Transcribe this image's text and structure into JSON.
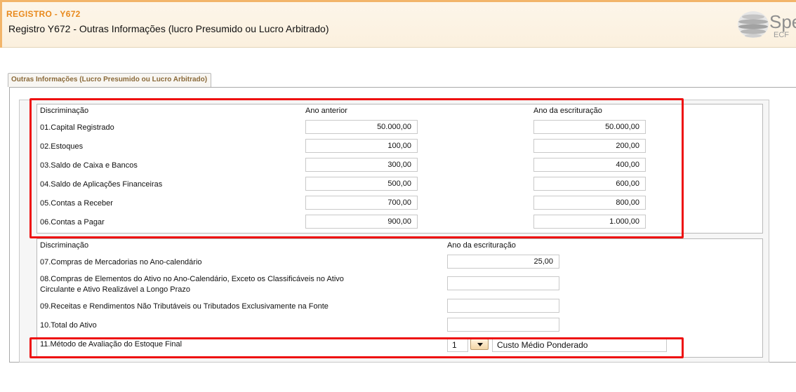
{
  "header": {
    "register_code": "REGISTRO - Y672",
    "register_title": "Registro Y672 - Outras Informações (lucro Presumido ou Lucro Arbitrado)",
    "logo_text": "Spe",
    "logo_sub": "ECF",
    "accent_color": "#e8891c"
  },
  "tab": {
    "label": "Outras Informações (Lucro Presumido ou Lucro Arbitrado)"
  },
  "section1": {
    "col_discriminacao": "Discriminação",
    "col_ano_anterior": "Ano anterior",
    "col_ano_escrituracao": "Ano da escrituração",
    "rows": [
      {
        "label": "01.Capital Registrado",
        "ano_anterior": "50.000,00",
        "ano_escrituracao": "50.000,00"
      },
      {
        "label": "02.Estoques",
        "ano_anterior": "100,00",
        "ano_escrituracao": "200,00"
      },
      {
        "label": "03.Saldo de Caixa e Bancos",
        "ano_anterior": "300,00",
        "ano_escrituracao": "400,00"
      },
      {
        "label": "04.Saldo de Aplicações Financeiras",
        "ano_anterior": "500,00",
        "ano_escrituracao": "600,00"
      },
      {
        "label": "05.Contas a Receber",
        "ano_anterior": "700,00",
        "ano_escrituracao": "800,00"
      },
      {
        "label": "06.Contas a Pagar",
        "ano_anterior": "900,00",
        "ano_escrituracao": "1.000,00"
      }
    ]
  },
  "section2": {
    "col_discriminacao": "Discriminação",
    "col_ano_escrituracao": "Ano da escrituração",
    "rows": [
      {
        "label": "07.Compras de Mercadorias no Ano-calendário",
        "value": "25,00"
      },
      {
        "label": "08.Compras de Elementos do Ativo no Ano-Calendário, Exceto os Classificáveis no Ativo Circulante e Ativo Realizável a Longo Prazo",
        "value": ""
      },
      {
        "label": "09.Receitas e Rendimentos Não Tributáveis ou Tributados Exclusivamente na Fonte",
        "value": ""
      },
      {
        "label": "10.Total do Ativo",
        "value": ""
      }
    ],
    "metodo": {
      "label": "11.Método de Avaliação do Estoque Final",
      "code": "1",
      "description": "Custo Médio Ponderado"
    }
  },
  "highlight_color": "#ee1111"
}
